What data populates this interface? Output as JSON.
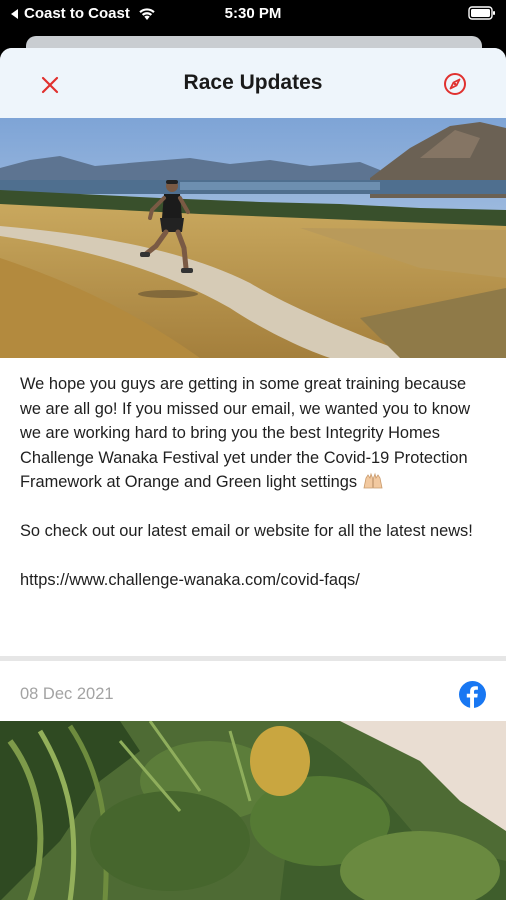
{
  "status_bar": {
    "back_app": "Coast to Coast",
    "time": "5:30 PM",
    "icons": [
      "back-arrow-icon",
      "wifi-icon",
      "battery-icon"
    ]
  },
  "header": {
    "title": "Race Updates",
    "left_icon": "close-icon",
    "right_icon": "compass-icon",
    "accent_color": "#e0312f"
  },
  "post": {
    "paragraph_1": "We hope you guys are getting in some great training because we are all go! If you missed our email, we wanted you to know we are working hard to bring you the best Integrity Homes Challenge Wanaka Festival yet under the Covid-19 Protection Framework at Orange and Green light settings",
    "emoji": "raising-hands-emoji",
    "paragraph_2": "So check out our latest email or website for all the latest news!",
    "link": "https://www.challenge-wanaka.com/covid-faqs/"
  },
  "next_post": {
    "date": "08 Dec 2021",
    "source_icon": "facebook-icon",
    "source_color": "#1877f2"
  }
}
